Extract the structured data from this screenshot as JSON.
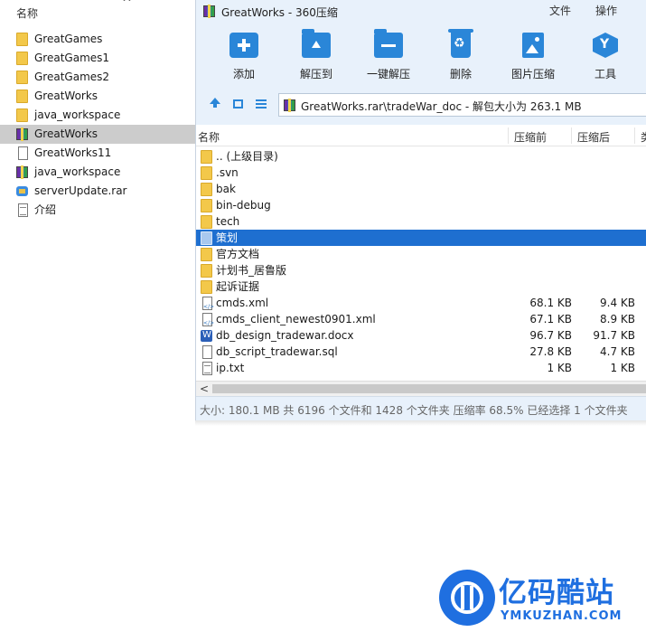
{
  "explorer": {
    "header_label": "名称",
    "caret": "^",
    "items": [
      {
        "label": "GreatGames",
        "type": "folder",
        "selected": false
      },
      {
        "label": "GreatGames1",
        "type": "folder",
        "selected": false
      },
      {
        "label": "GreatGames2",
        "type": "folder",
        "selected": false
      },
      {
        "label": "GreatWorks",
        "type": "folder",
        "selected": false
      },
      {
        "label": "java_workspace",
        "type": "folder",
        "selected": false
      },
      {
        "label": "GreatWorks",
        "type": "rar",
        "selected": true
      },
      {
        "label": "GreatWorks11",
        "type": "file",
        "selected": false
      },
      {
        "label": "java_workspace",
        "type": "rar",
        "selected": false
      },
      {
        "label": "serverUpdate.rar",
        "type": "update",
        "selected": false
      },
      {
        "label": "介绍",
        "type": "txt",
        "selected": false
      }
    ]
  },
  "window": {
    "title": "GreatWorks - 360压缩",
    "menu": [
      "文件",
      "操作"
    ],
    "toolbar": [
      {
        "label": "添加",
        "icon": "add-icon"
      },
      {
        "label": "解压到",
        "icon": "extract-to-icon"
      },
      {
        "label": "一键解压",
        "icon": "one-click-extract-icon"
      },
      {
        "label": "删除",
        "icon": "delete-icon"
      },
      {
        "label": "图片压缩",
        "icon": "image-compress-icon"
      },
      {
        "label": "工具",
        "icon": "tools-icon"
      }
    ],
    "address": "GreatWorks.rar\\tradeWar_doc - 解包大小为 263.1 MB",
    "columns": {
      "name": "名称",
      "packed": "压缩前",
      "compressed": "压缩后",
      "more": "类"
    },
    "rows": [
      {
        "name": ".. (上级目录)",
        "type": "folder",
        "packed": "",
        "compressed": "",
        "selected": false
      },
      {
        "name": ".svn",
        "type": "folder",
        "packed": "",
        "compressed": "",
        "selected": false
      },
      {
        "name": "bak",
        "type": "folder",
        "packed": "",
        "compressed": "",
        "selected": false
      },
      {
        "name": "bin-debug",
        "type": "folder",
        "packed": "",
        "compressed": "",
        "selected": false
      },
      {
        "name": "tech",
        "type": "folder",
        "packed": "",
        "compressed": "",
        "selected": false
      },
      {
        "name": "策划",
        "type": "folder",
        "packed": "",
        "compressed": "",
        "selected": true
      },
      {
        "name": "官方文档",
        "type": "folder",
        "packed": "",
        "compressed": "",
        "selected": false
      },
      {
        "name": "计划书_居鲁版",
        "type": "folder",
        "packed": "",
        "compressed": "",
        "selected": false
      },
      {
        "name": "起诉证据",
        "type": "folder",
        "packed": "",
        "compressed": "",
        "selected": false
      },
      {
        "name": "cmds.xml",
        "type": "xml",
        "packed": "68.1 KB",
        "compressed": "9.4 KB",
        "selected": false
      },
      {
        "name": "cmds_client_newest0901.xml",
        "type": "xml",
        "packed": "67.1 KB",
        "compressed": "8.9 KB",
        "selected": false
      },
      {
        "name": "db_design_tradewar.docx",
        "type": "doc",
        "packed": "96.7 KB",
        "compressed": "91.7 KB",
        "selected": false
      },
      {
        "name": "db_script_tradewar.sql",
        "type": "file",
        "packed": "27.8 KB",
        "compressed": "4.7 KB",
        "selected": false
      },
      {
        "name": "ip.txt",
        "type": "txt",
        "packed": "1 KB",
        "compressed": "1 KB",
        "selected": false
      }
    ],
    "scroll_left": "<",
    "status": "大小: 180.1 MB 共 6196 个文件和 1428 个文件夹 压缩率 68.5% 已经选择 1 个文件夹"
  },
  "watermark": {
    "brand": "亿码酷站",
    "sub": "YMKUZHAN.COM"
  },
  "colors": {
    "accent": "#2a86d8",
    "selection": "#1e6fd0",
    "chrome": "#e8f1fb",
    "brand": "#1f6fe0"
  }
}
